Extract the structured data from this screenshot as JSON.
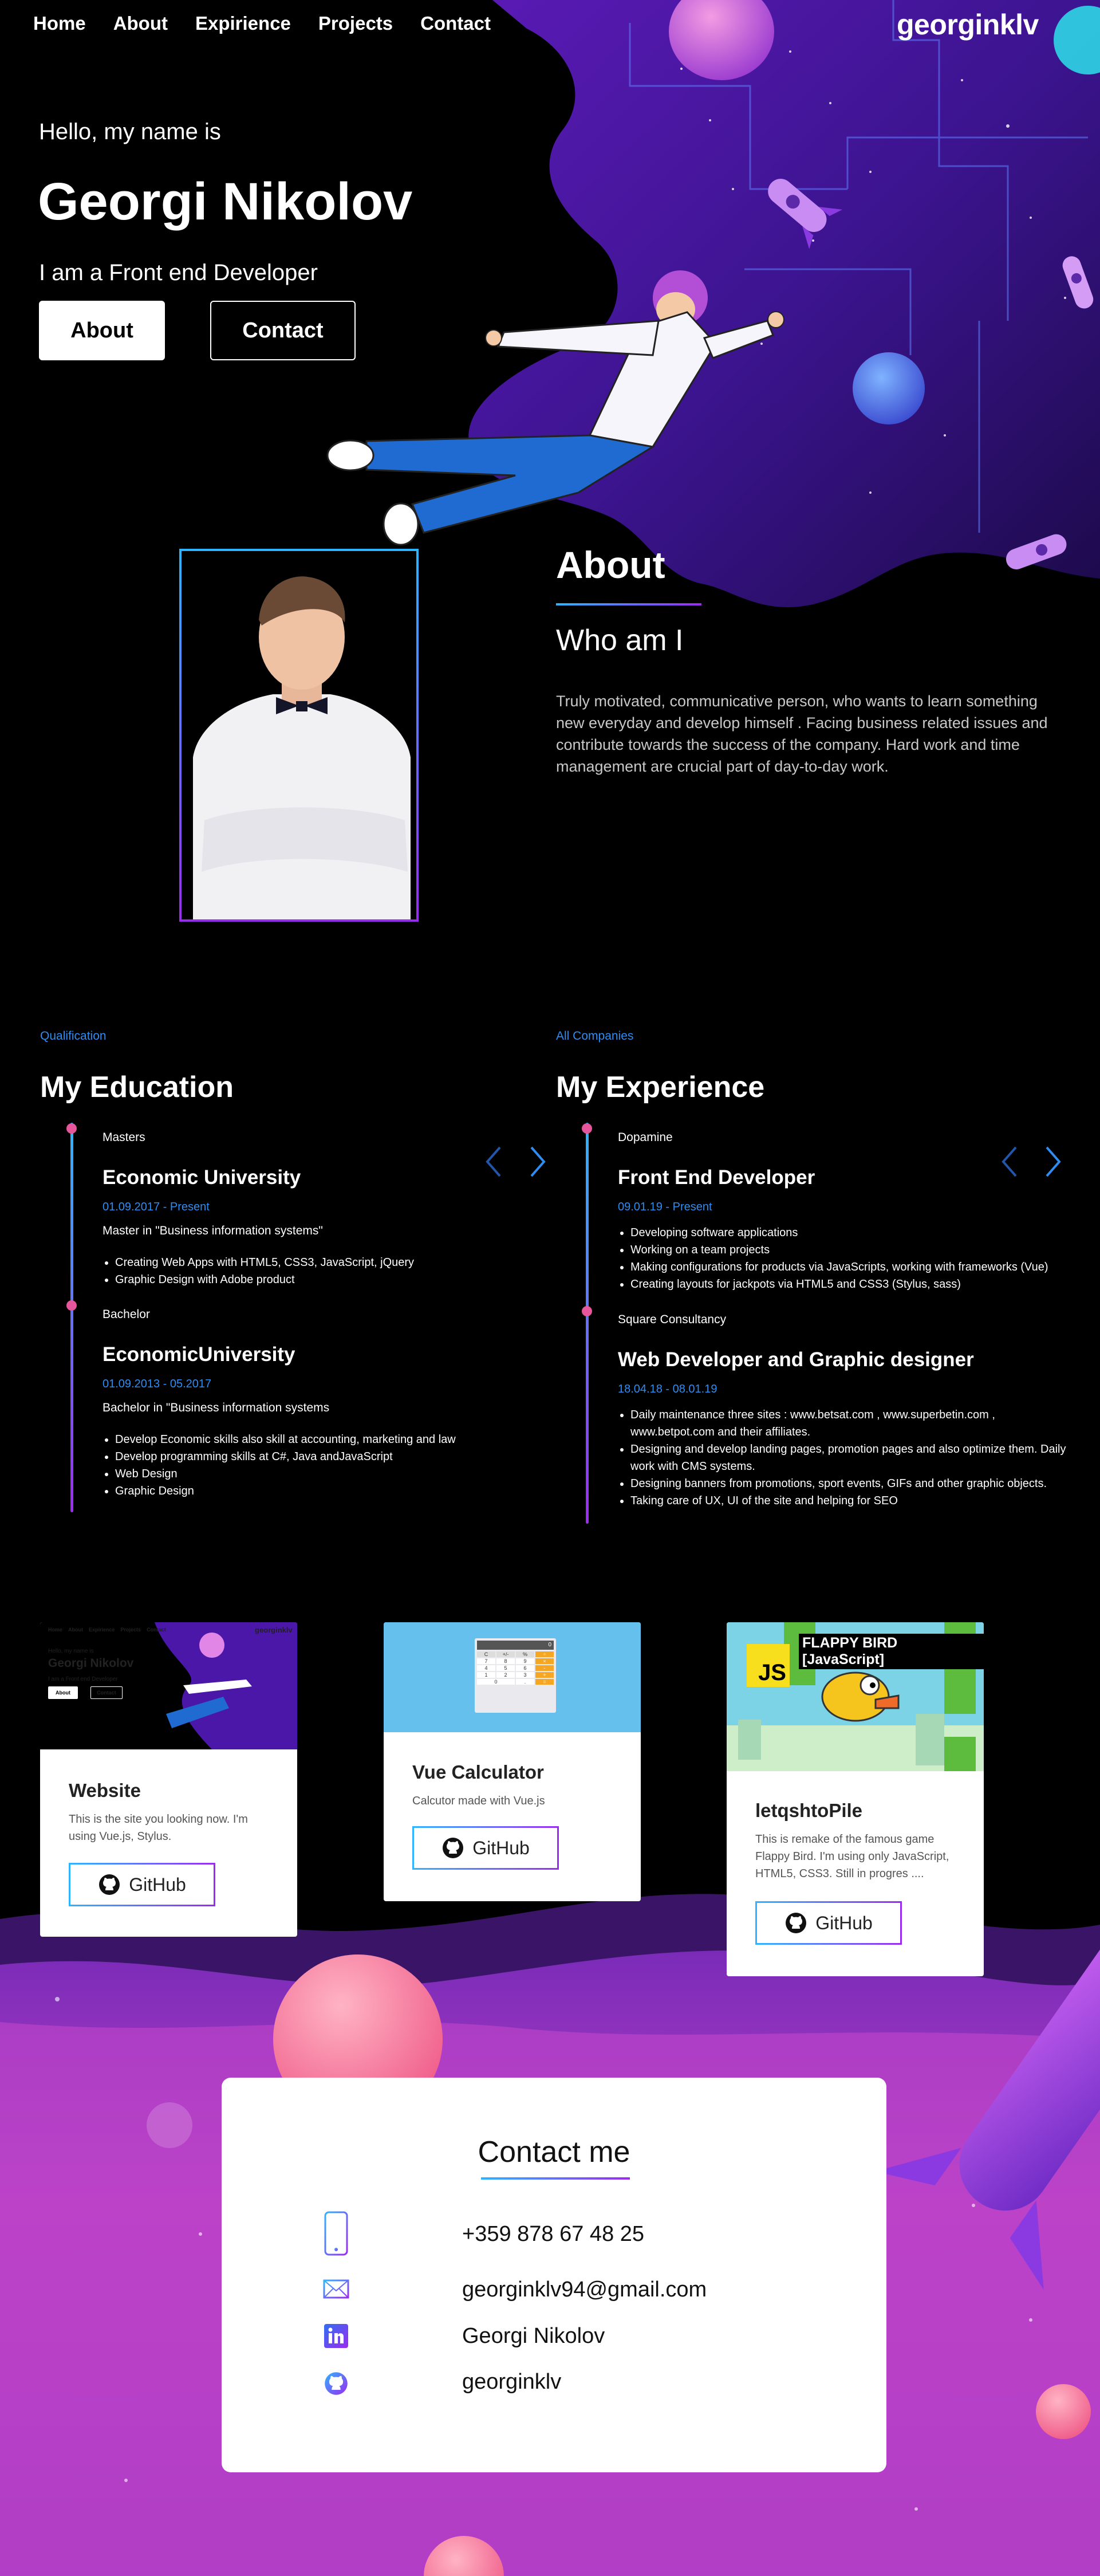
{
  "nav": {
    "links": [
      "Home",
      "About",
      "Expirience",
      "Projects",
      "Contact"
    ],
    "brand": "georginklv"
  },
  "hero": {
    "greeting": "Hello, my name is",
    "name": "Georgi Nikolov",
    "role": "I am a Front end Developer",
    "about_button": "About",
    "contact_button": "Contact"
  },
  "about": {
    "title": "About",
    "subtitle": "Who am I",
    "text": "Truly motivated, communicative person, who wants to learn something new everyday and develop himself . Facing business related issues and contribute towards the success of the company. Hard work and time management are crucial part of day-to-day work."
  },
  "education": {
    "kicker": "Qualification",
    "title": "My Education",
    "items": [
      {
        "kind": "Masters",
        "school": "Economic University",
        "dates": "01.09.2017 - Present",
        "degree": "Master in \"Business information systems\"",
        "bullets": [
          "Creating Web Apps with HTML5, CSS3, JavaScript, jQuery",
          "Graphic Design with Adobe product"
        ]
      },
      {
        "kind": "Bachelor",
        "school": "EconomicUniversity",
        "dates": "01.09.2013 - 05.2017",
        "degree": "Bachelor in \"Business information systems",
        "bullets": [
          "Develop Economic skills also skill at accounting, marketing and law",
          "Develop programming skills at C#, Java andJavaScript",
          "Web Design",
          "Graphic Design"
        ]
      }
    ]
  },
  "experience": {
    "kicker": "All Companies",
    "title": "My Experience",
    "items": [
      {
        "company": "Dopamine",
        "role": "Front End Developer",
        "dates": "09.01.19 - Present",
        "bullets": [
          "Developing software applications",
          "Working on a team projects",
          "Making configurations for products via JavaScripts, working with frameworks (Vue)",
          "Creating layouts for jackpots via HTML5 and CSS3 (Stylus, sass)"
        ]
      },
      {
        "company": "Square Consultancy",
        "role": "Web Developer and Graphic designer",
        "dates": "18.04.18 - 08.01.19",
        "bullets": [
          "Daily maintenance three sites : www.betsat.com , www.superbetin.com , www.betpot.com and their affiliates.",
          "Designing and develop landing pages, promotion pages and also optimize them. Daily work with CMS systems.",
          "Designing banners from promotions, sport events, GIFs and other graphic objects.",
          "Taking care of UX, UI of the site and helping for SEO"
        ]
      }
    ]
  },
  "projects": [
    {
      "title": "Website",
      "desc": "This is the site you looking now. I'm using Vue.js, Stylus.",
      "button": "GitHub",
      "thumb": {
        "nav": [
          "Home",
          "About",
          "Expirience",
          "Projects",
          "Contact"
        ],
        "brand": "georginklv",
        "greeting": "Hello, my name is",
        "name": "Georgi Nikolov",
        "role": "I am a Front end Developer",
        "btn1": "About",
        "btn2": "Contact"
      }
    },
    {
      "title": "Vue Calculator",
      "desc": "Calcutor made with Vue.js",
      "button": "GitHub",
      "thumb": {
        "display": "0",
        "keys": [
          "C",
          "+/-",
          "%",
          "÷",
          "7",
          "8",
          "9",
          "×",
          "4",
          "5",
          "6",
          "-",
          "1",
          "2",
          "3",
          "+",
          "0",
          ".",
          "="
        ]
      }
    },
    {
      "title": "letqshtoPile",
      "desc": "This is remake of the famous game Flappy Bird. I'm using only JavaScript, HTML5, CSS3. Still in progres ....",
      "button": "GitHub",
      "thumb": {
        "badge": "JS",
        "caption": "FLAPPY BIRD [JavaScript]"
      }
    }
  ],
  "contact": {
    "title": "Contact me",
    "phone": "+359 878 67 48 25",
    "email": "georginklv94@gmail.com",
    "linkedin": "Georgi Nikolov",
    "github": "georginklv"
  },
  "colors": {
    "accent_blue": "#2f8cf0",
    "accent_purple": "#9a2cf0",
    "timeline_dot": "#e6569b",
    "footer_magenta": "#c53ec9"
  },
  "icons": [
    "phone-icon",
    "mail-icon",
    "linkedin-icon",
    "github-icon",
    "chevron-left-icon",
    "chevron-right-icon",
    "rocket-icon",
    "planet-icon"
  ]
}
